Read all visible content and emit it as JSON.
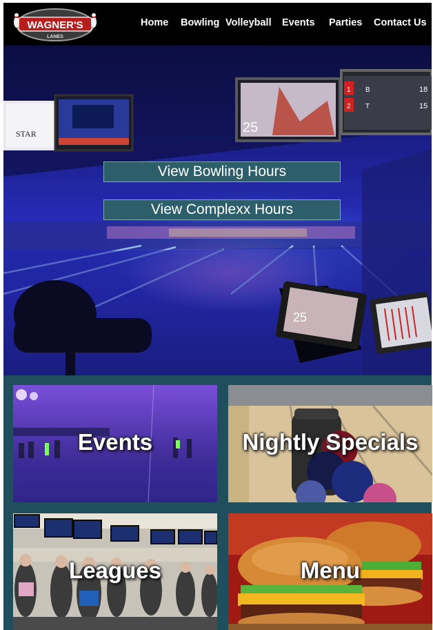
{
  "header": {
    "logo": {
      "text": "WAGNER'S",
      "subtext": "LANES"
    },
    "nav": [
      "Home",
      "Bowling",
      "Volleyball",
      "Events",
      "Parties",
      "Contact Us"
    ]
  },
  "hero": {
    "buttons": {
      "bowling_hours": "View Bowling Hours",
      "complexx_hours": "View Complexx Hours"
    },
    "screens": {
      "score_a": "25",
      "score_b": "25",
      "score_c": "25",
      "rows": [
        "1",
        "2"
      ],
      "players": [
        "B",
        "T"
      ],
      "totals": [
        "18",
        "15"
      ],
      "star_text": "STAR"
    }
  },
  "tiles": [
    {
      "label": "Events"
    },
    {
      "label": "Nightly Specials"
    },
    {
      "label": "Leagues"
    },
    {
      "label": "Menu"
    }
  ],
  "colors": {
    "header_bg": "#000000",
    "button_bg": "#2d5f6b",
    "grid_bg": "#1f4f5d",
    "hero_blue": "#262bb5"
  }
}
